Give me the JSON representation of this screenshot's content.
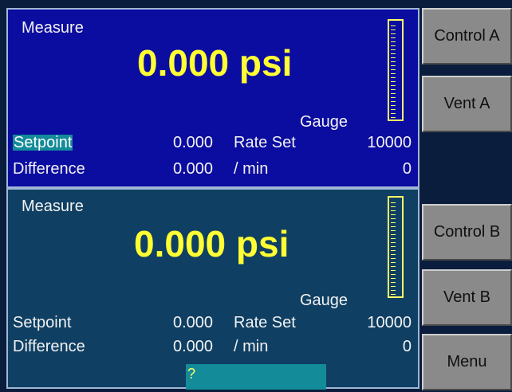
{
  "channel_a": {
    "title": "Measure",
    "reading": "0.000 psi",
    "mode": "Gauge",
    "setpoint_label": "Setpoint",
    "setpoint_value": "0.000",
    "rate_label": "Rate Set",
    "rate_value": "10000",
    "difference_label": "Difference",
    "difference_value": "0.000",
    "per_min_label": "/ min",
    "per_min_value": "0",
    "gauge_level": 0
  },
  "channel_b": {
    "title": "Measure",
    "reading": "0.000 psi",
    "mode": "Gauge",
    "setpoint_label": "Setpoint",
    "setpoint_value": "0.000",
    "rate_label": "Rate Set",
    "rate_value": "10000",
    "difference_label": "Difference",
    "difference_value": "0.000",
    "per_min_label": "/ min",
    "per_min_value": "0",
    "gauge_level": 0
  },
  "buttons": {
    "control_a": "Control A",
    "vent_a": "Vent A",
    "control_b": "Control B",
    "vent_b": "Vent B",
    "menu": "Menu"
  },
  "prompt": {
    "text": "?"
  },
  "colors": {
    "panel_a_bg": "#0b0ca0",
    "panel_b_bg": "#0f3f63",
    "reading": "#ffff33",
    "highlight": "#138b99",
    "button": "#8a8a8a"
  }
}
